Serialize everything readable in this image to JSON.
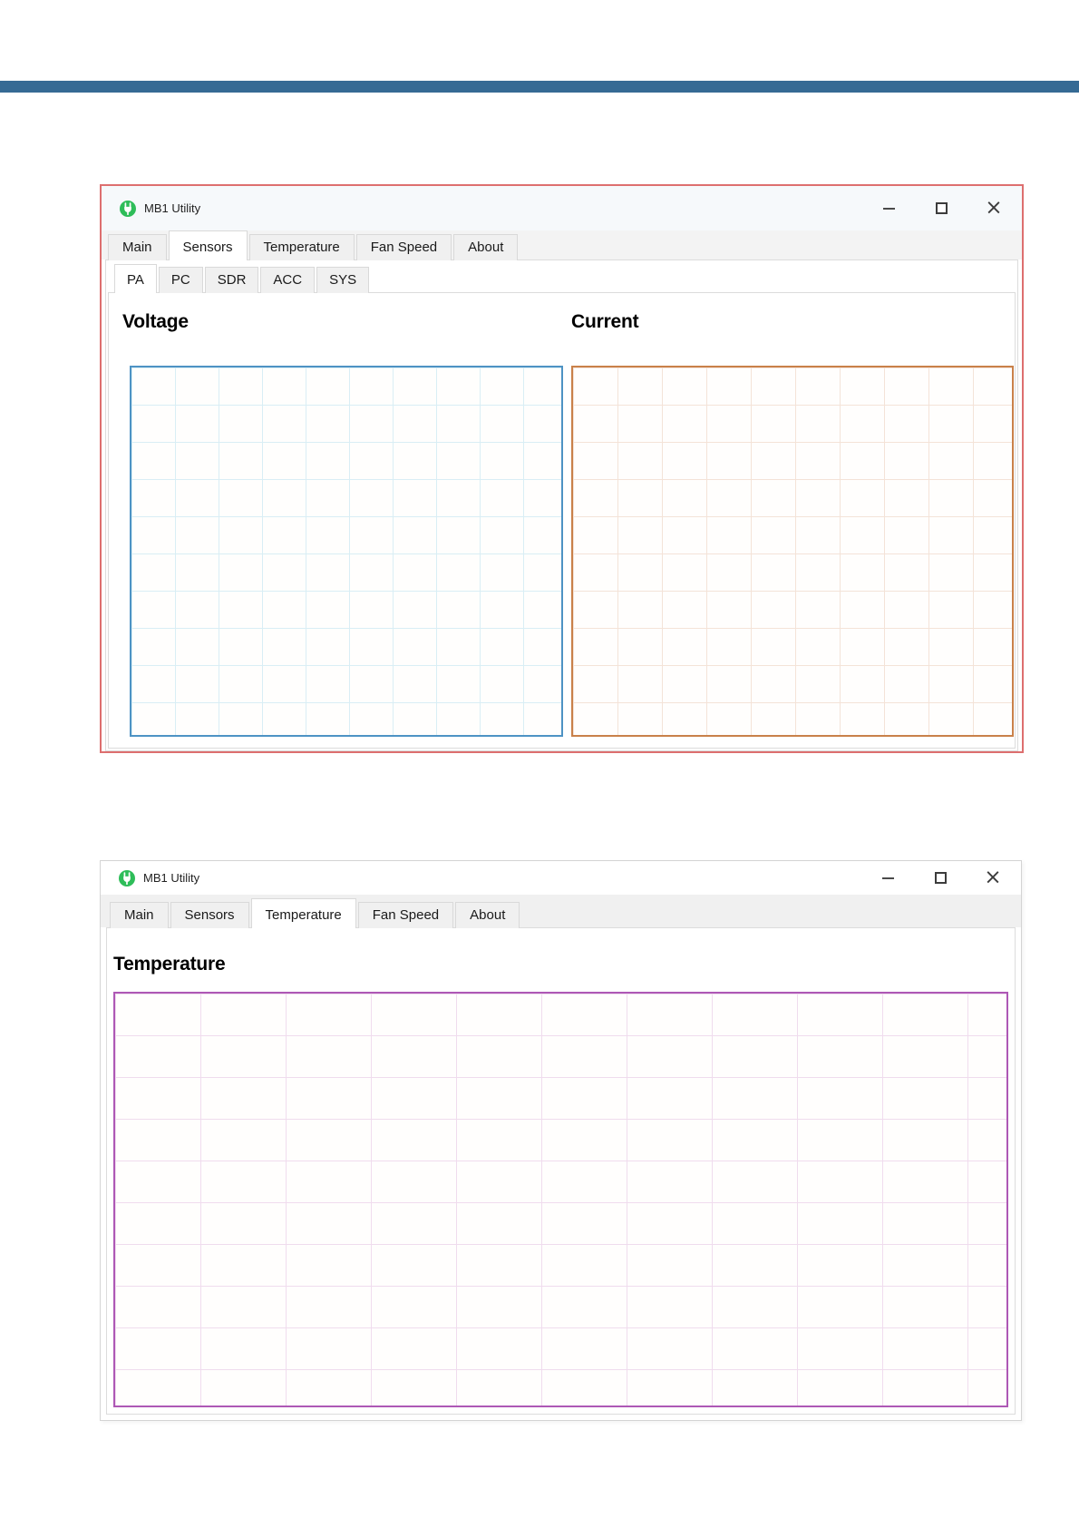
{
  "page": {
    "top_bar_color": "#356a94"
  },
  "window1": {
    "title": "MB1 Utility",
    "border_color": "#dd6f6f",
    "controls": {
      "close": "×"
    },
    "tabs": [
      "Main",
      "Sensors",
      "Temperature",
      "Fan Speed",
      "About"
    ],
    "selected_tab": "Sensors",
    "subtabs": [
      "PA",
      "PC",
      "SDR",
      "ACC",
      "SYS"
    ],
    "selected_subtab": "PA",
    "charts": [
      {
        "title": "Voltage",
        "border_color": "#4e93c4",
        "grid_color": "#d9eef5",
        "series": []
      },
      {
        "title": "Current",
        "border_color": "#c9814a",
        "grid_color": "#f4e3d8",
        "series": []
      }
    ]
  },
  "window2": {
    "title": "MB1 Utility",
    "controls": {
      "close": "×"
    },
    "tabs": [
      "Main",
      "Sensors",
      "Temperature",
      "Fan Speed",
      "About"
    ],
    "selected_tab": "Temperature",
    "chart": {
      "title": "Temperature",
      "border_color": "#ae58b5",
      "grid_color": "#f0dcee",
      "series": []
    }
  }
}
